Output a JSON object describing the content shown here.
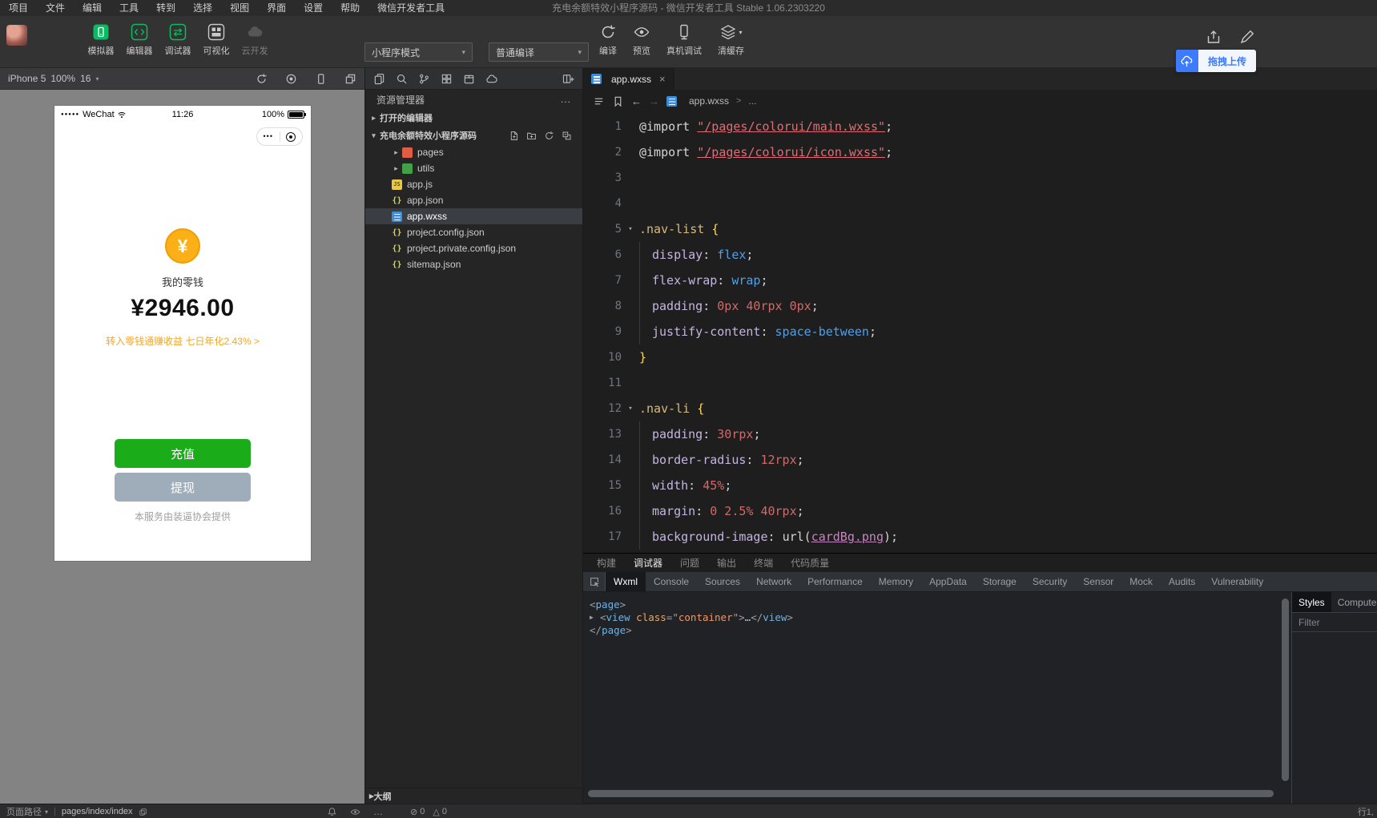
{
  "colors": {
    "wechat_green": "#07c160",
    "recharge_green": "#1aad19",
    "withdraw_gray": "#9fadba",
    "coin_orange": "#fbb017",
    "promo_orange": "#f5a623",
    "upload_blue": "#3e7bfa",
    "wxss_icon_blue": "#3f8cd6"
  },
  "menu_bar": {
    "items": [
      "项目",
      "文件",
      "编辑",
      "工具",
      "转到",
      "选择",
      "视图",
      "界面",
      "设置",
      "帮助",
      "微信开发者工具"
    ],
    "title": "充电余额特效小程序源码 - 微信开发者工具 Stable 1.06.2303220"
  },
  "toolbar": {
    "buttons": [
      {
        "label": "模拟器",
        "icon": "simulator-icon",
        "state": "normal"
      },
      {
        "label": "编辑器",
        "icon": "editor-icon",
        "state": "normal"
      },
      {
        "label": "调试器",
        "icon": "debugger-icon",
        "state": "normal"
      },
      {
        "label": "可视化",
        "icon": "visualizer-icon",
        "state": "normal"
      },
      {
        "label": "云开发",
        "icon": "cloud-dev-icon",
        "state": "disabled"
      }
    ],
    "mode_select": {
      "value": "小程序模式"
    },
    "compile_select": {
      "value": "普通编译"
    },
    "actions": [
      {
        "label": "编译",
        "icon": "compile-icon",
        "has_caret": false
      },
      {
        "label": "预览",
        "icon": "preview-icon",
        "has_caret": false
      },
      {
        "label": "真机调试",
        "icon": "remote-debug-icon",
        "has_caret": false
      },
      {
        "label": "清缓存",
        "icon": "clear-cache-icon",
        "has_caret": true
      }
    ],
    "drag_upload_label": "拖拽上传"
  },
  "simulator": {
    "device_label": "iPhone 5",
    "zoom_label": "100%",
    "network_label": "16",
    "phone": {
      "signal": "●●●●●",
      "carrier": "WeChat",
      "time": "11:26",
      "battery": "100%",
      "capsule_dots": "•••",
      "coin_symbol": "¥",
      "wallet_label": "我的零钱",
      "balance": "¥2946.00",
      "promo_text": "转入零钱通赚收益 七日年化2.43% >",
      "recharge_label": "充值",
      "withdraw_label": "提现",
      "footer_text": "本服务由装逼协会提供"
    }
  },
  "explorer": {
    "title": "资源管理器",
    "more_label": "...",
    "open_editors_label": "打开的编辑器",
    "project_name": "充电余额特效小程序源码",
    "tree": [
      {
        "label": "pages",
        "kind": "folder",
        "icon": "pages-folder-icon"
      },
      {
        "label": "utils",
        "kind": "folder",
        "icon": "utils-folder-icon"
      },
      {
        "label": "app.js",
        "kind": "file",
        "icon": "js-file-icon"
      },
      {
        "label": "app.json",
        "kind": "file",
        "icon": "json-file-icon"
      },
      {
        "label": "app.wxss",
        "kind": "file",
        "icon": "wxss-file-icon",
        "selected": true
      },
      {
        "label": "project.config.json",
        "kind": "file",
        "icon": "json-file-icon"
      },
      {
        "label": "project.private.config.json",
        "kind": "file",
        "icon": "json-file-icon"
      },
      {
        "label": "sitemap.json",
        "kind": "file",
        "icon": "json-file-icon"
      }
    ],
    "outline_label": "大纲"
  },
  "editor": {
    "tab_label": "app.wxss",
    "breadcrumb_file": "app.wxss",
    "breadcrumb_sep": ">",
    "breadcrumb_more": "...",
    "code": [
      {
        "n": 1,
        "tokens": [
          [
            "kw",
            "@import "
          ],
          [
            "strlink",
            "\"/pages/colorui/main.wxss\""
          ],
          [
            "pun",
            ";"
          ]
        ]
      },
      {
        "n": 2,
        "tokens": [
          [
            "kw",
            "@import "
          ],
          [
            "strlink",
            "\"/pages/colorui/icon.wxss\""
          ],
          [
            "pun",
            ";"
          ]
        ]
      },
      {
        "n": 3,
        "tokens": []
      },
      {
        "n": 4,
        "tokens": []
      },
      {
        "n": 5,
        "fold": true,
        "tokens": [
          [
            "sel",
            ".nav-list"
          ],
          [
            "pun",
            " "
          ],
          [
            "brace",
            "{"
          ]
        ]
      },
      {
        "n": 6,
        "tokens": [
          [
            "ind",
            ""
          ],
          [
            "prop",
            "display"
          ],
          [
            "pun",
            ": "
          ],
          [
            "val",
            "flex"
          ],
          [
            "pun",
            ";"
          ]
        ]
      },
      {
        "n": 7,
        "tokens": [
          [
            "ind",
            ""
          ],
          [
            "prop",
            "flex-wrap"
          ],
          [
            "pun",
            ": "
          ],
          [
            "val",
            "wrap"
          ],
          [
            "pun",
            ";"
          ]
        ]
      },
      {
        "n": 8,
        "tokens": [
          [
            "ind",
            ""
          ],
          [
            "prop",
            "padding"
          ],
          [
            "pun",
            ": "
          ],
          [
            "num",
            "0px 40rpx 0px"
          ],
          [
            "pun",
            ";"
          ]
        ]
      },
      {
        "n": 9,
        "tokens": [
          [
            "ind",
            ""
          ],
          [
            "prop",
            "justify-content"
          ],
          [
            "pun",
            ": "
          ],
          [
            "val",
            "space-between"
          ],
          [
            "pun",
            ";"
          ]
        ]
      },
      {
        "n": 10,
        "tokens": [
          [
            "brace",
            "}"
          ]
        ]
      },
      {
        "n": 11,
        "tokens": []
      },
      {
        "n": 12,
        "fold": true,
        "tokens": [
          [
            "sel",
            ".nav-li"
          ],
          [
            "pun",
            " "
          ],
          [
            "brace",
            "{"
          ]
        ]
      },
      {
        "n": 13,
        "tokens": [
          [
            "ind",
            ""
          ],
          [
            "prop",
            "padding"
          ],
          [
            "pun",
            ": "
          ],
          [
            "num",
            "30rpx"
          ],
          [
            "pun",
            ";"
          ]
        ]
      },
      {
        "n": 14,
        "tokens": [
          [
            "ind",
            ""
          ],
          [
            "prop",
            "border-radius"
          ],
          [
            "pun",
            ": "
          ],
          [
            "num",
            "12rpx"
          ],
          [
            "pun",
            ";"
          ]
        ]
      },
      {
        "n": 15,
        "tokens": [
          [
            "ind",
            ""
          ],
          [
            "prop",
            "width"
          ],
          [
            "pun",
            ": "
          ],
          [
            "num",
            "45%"
          ],
          [
            "pun",
            ";"
          ]
        ]
      },
      {
        "n": 16,
        "tokens": [
          [
            "ind",
            ""
          ],
          [
            "prop",
            "margin"
          ],
          [
            "pun",
            ": "
          ],
          [
            "num",
            "0 2.5% 40rpx"
          ],
          [
            "pun",
            ";"
          ]
        ]
      },
      {
        "n": 17,
        "tokens": [
          [
            "ind",
            ""
          ],
          [
            "prop",
            "background-image"
          ],
          [
            "pun",
            ": "
          ],
          [
            "fn",
            "url("
          ],
          [
            "maglink",
            "cardBg.png"
          ],
          [
            "fn",
            ")"
          ],
          [
            "pun",
            ";"
          ]
        ]
      }
    ]
  },
  "debugger": {
    "panel_tabs": [
      "构建",
      "调试器",
      "问题",
      "输出",
      "终端",
      "代码质量"
    ],
    "active_panel_tab": "调试器",
    "devtools_tabs": [
      "Wxml",
      "Console",
      "Sources",
      "Network",
      "Performance",
      "Memory",
      "AppData",
      "Storage",
      "Security",
      "Sensor",
      "Mock",
      "Audits",
      "Vulnerability"
    ],
    "active_devtools_tab": "Wxml",
    "wxml": [
      {
        "expand": "",
        "tokens": [
          [
            "br",
            "<"
          ],
          [
            "tag",
            "page"
          ],
          [
            "br",
            ">"
          ]
        ]
      },
      {
        "expand": "▶",
        "tokens": [
          [
            "br",
            "<"
          ],
          [
            "tag",
            "view"
          ],
          [
            "plain",
            " "
          ],
          [
            "attr",
            "class"
          ],
          [
            "br",
            "=\""
          ],
          [
            "attrv",
            "container"
          ],
          [
            "br",
            "\">"
          ],
          [
            "dots",
            "…"
          ],
          [
            "br",
            "</"
          ],
          [
            "tag",
            "view"
          ],
          [
            "br",
            ">"
          ]
        ]
      },
      {
        "expand": "",
        "tokens": [
          [
            "br",
            "</"
          ],
          [
            "tag",
            "page"
          ],
          [
            "br",
            ">"
          ]
        ]
      }
    ],
    "styles_tabs": [
      "Styles",
      "Computed"
    ],
    "active_styles_tab": "Styles",
    "filter_label": "Filter"
  },
  "status_bar": {
    "page_path_label": "页面路径",
    "page_path_value": "pages/index/index",
    "error_count": "0",
    "warning_count": "0",
    "caret_label": "行1,"
  }
}
